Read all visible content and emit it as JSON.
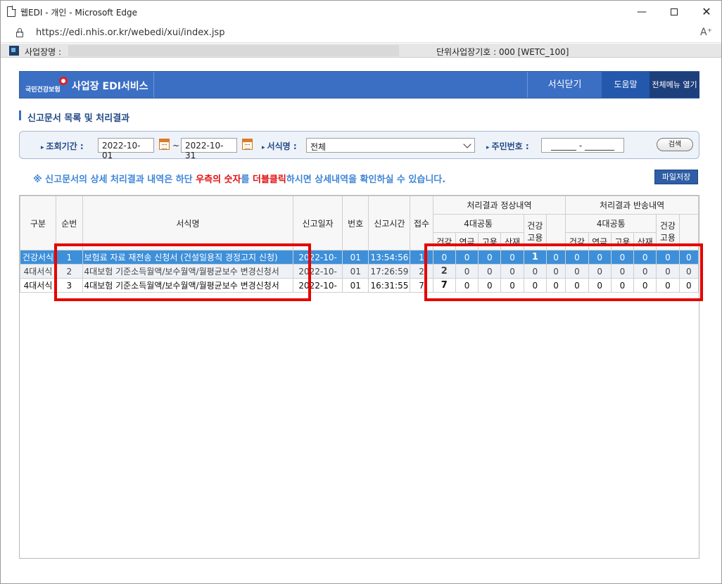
{
  "window": {
    "title": "웹EDI - 개인 - Microsoft Edge",
    "url": "https://edi.nhis.or.kr/webedi/xui/index.jsp"
  },
  "site_bar": {
    "name_label": "사업장명 :",
    "code": "단위사업장기호 : 000 [WETC_100]"
  },
  "header": {
    "logo_text": "국민건강보험",
    "title": "사업장 EDI서비스",
    "close_form": "서식닫기",
    "help": "도움말",
    "all_menu": "전체메뉴 열기"
  },
  "section_title": "신고문서 목록 및 처리결과",
  "search": {
    "period_label": "조회기간 :",
    "date_from": "2022-10-01",
    "tilde": "~",
    "date_to": "2022-10-31",
    "form_label": "서식명 :",
    "form_value": "전체",
    "rrn_label": "주민번호 :",
    "rrn_value": "______ - _______",
    "search_button": "검색"
  },
  "notice": {
    "prefix": "※ 신고문서의 상세 처리결과 내역은 하단 ",
    "red1": "우측의 숫자",
    "mid": "를 ",
    "red2": "더블클릭",
    "suffix": "하시면 상세내역을 확인하실 수 있습니다."
  },
  "save_file_button": "파일저장",
  "grid": {
    "headers": {
      "category": "구분",
      "seq": "순번",
      "form_name": "서식명",
      "report_date": "신고일자",
      "number": "번호",
      "report_time": "신고시간",
      "received": "접수",
      "normal_group": "처리결과 정상내역",
      "returned_group": "처리결과 반송내역",
      "four_common": "4대공통",
      "health": "건강",
      "health_sub": "건강",
      "pension": "연금",
      "employment": "고용",
      "accident": "산재",
      "employment_single": "고용"
    },
    "rows": [
      {
        "category": "건강서식",
        "seq": "1",
        "form_name": "보험료 자료 재전송 신청서 (건설일용직 경정고지 신청)",
        "date": "2022-10-",
        "number": "01",
        "time": "13:54:56",
        "received": "1",
        "n_health": "0",
        "n_pension": "0",
        "n_employment": "0",
        "n_accident": "0",
        "n_health_single": "1",
        "n_employment_single": "0",
        "r_health": "0",
        "r_pension": "0",
        "r_employment": "0",
        "r_accident": "0",
        "r_health_single": "0",
        "r_employment_single": "0"
      },
      {
        "category": "4대서식",
        "seq": "2",
        "form_name": "4대보험 기준소득월액/보수월액/월평균보수 변경신청서",
        "date": "2022-10-",
        "number": "01",
        "time": "17:26:59",
        "received": "2",
        "n_health": "2",
        "n_pension": "0",
        "n_employment": "0",
        "n_accident": "0",
        "n_health_single": "0",
        "n_employment_single": "0",
        "r_health": "0",
        "r_pension": "0",
        "r_employment": "0",
        "r_accident": "0",
        "r_health_single": "0",
        "r_employment_single": "0"
      },
      {
        "category": "4대서식",
        "seq": "3",
        "form_name": "4대보험 기준소득월액/보수월액/월평균보수 변경신청서",
        "date": "2022-10-",
        "number": "01",
        "time": "16:31:55",
        "received": "7",
        "n_health": "7",
        "n_pension": "0",
        "n_employment": "0",
        "n_accident": "0",
        "n_health_single": "0",
        "n_employment_single": "0",
        "r_health": "0",
        "r_pension": "0",
        "r_employment": "0",
        "r_accident": "0",
        "r_health_single": "0",
        "r_employment_single": "0"
      }
    ]
  },
  "colors": {
    "header_blue": "#3b6fc4",
    "selected_row": "#3d8fd9",
    "highlight_red": "#e60000",
    "notice_blue": "#3f86d8",
    "notice_red": "#e01010"
  }
}
